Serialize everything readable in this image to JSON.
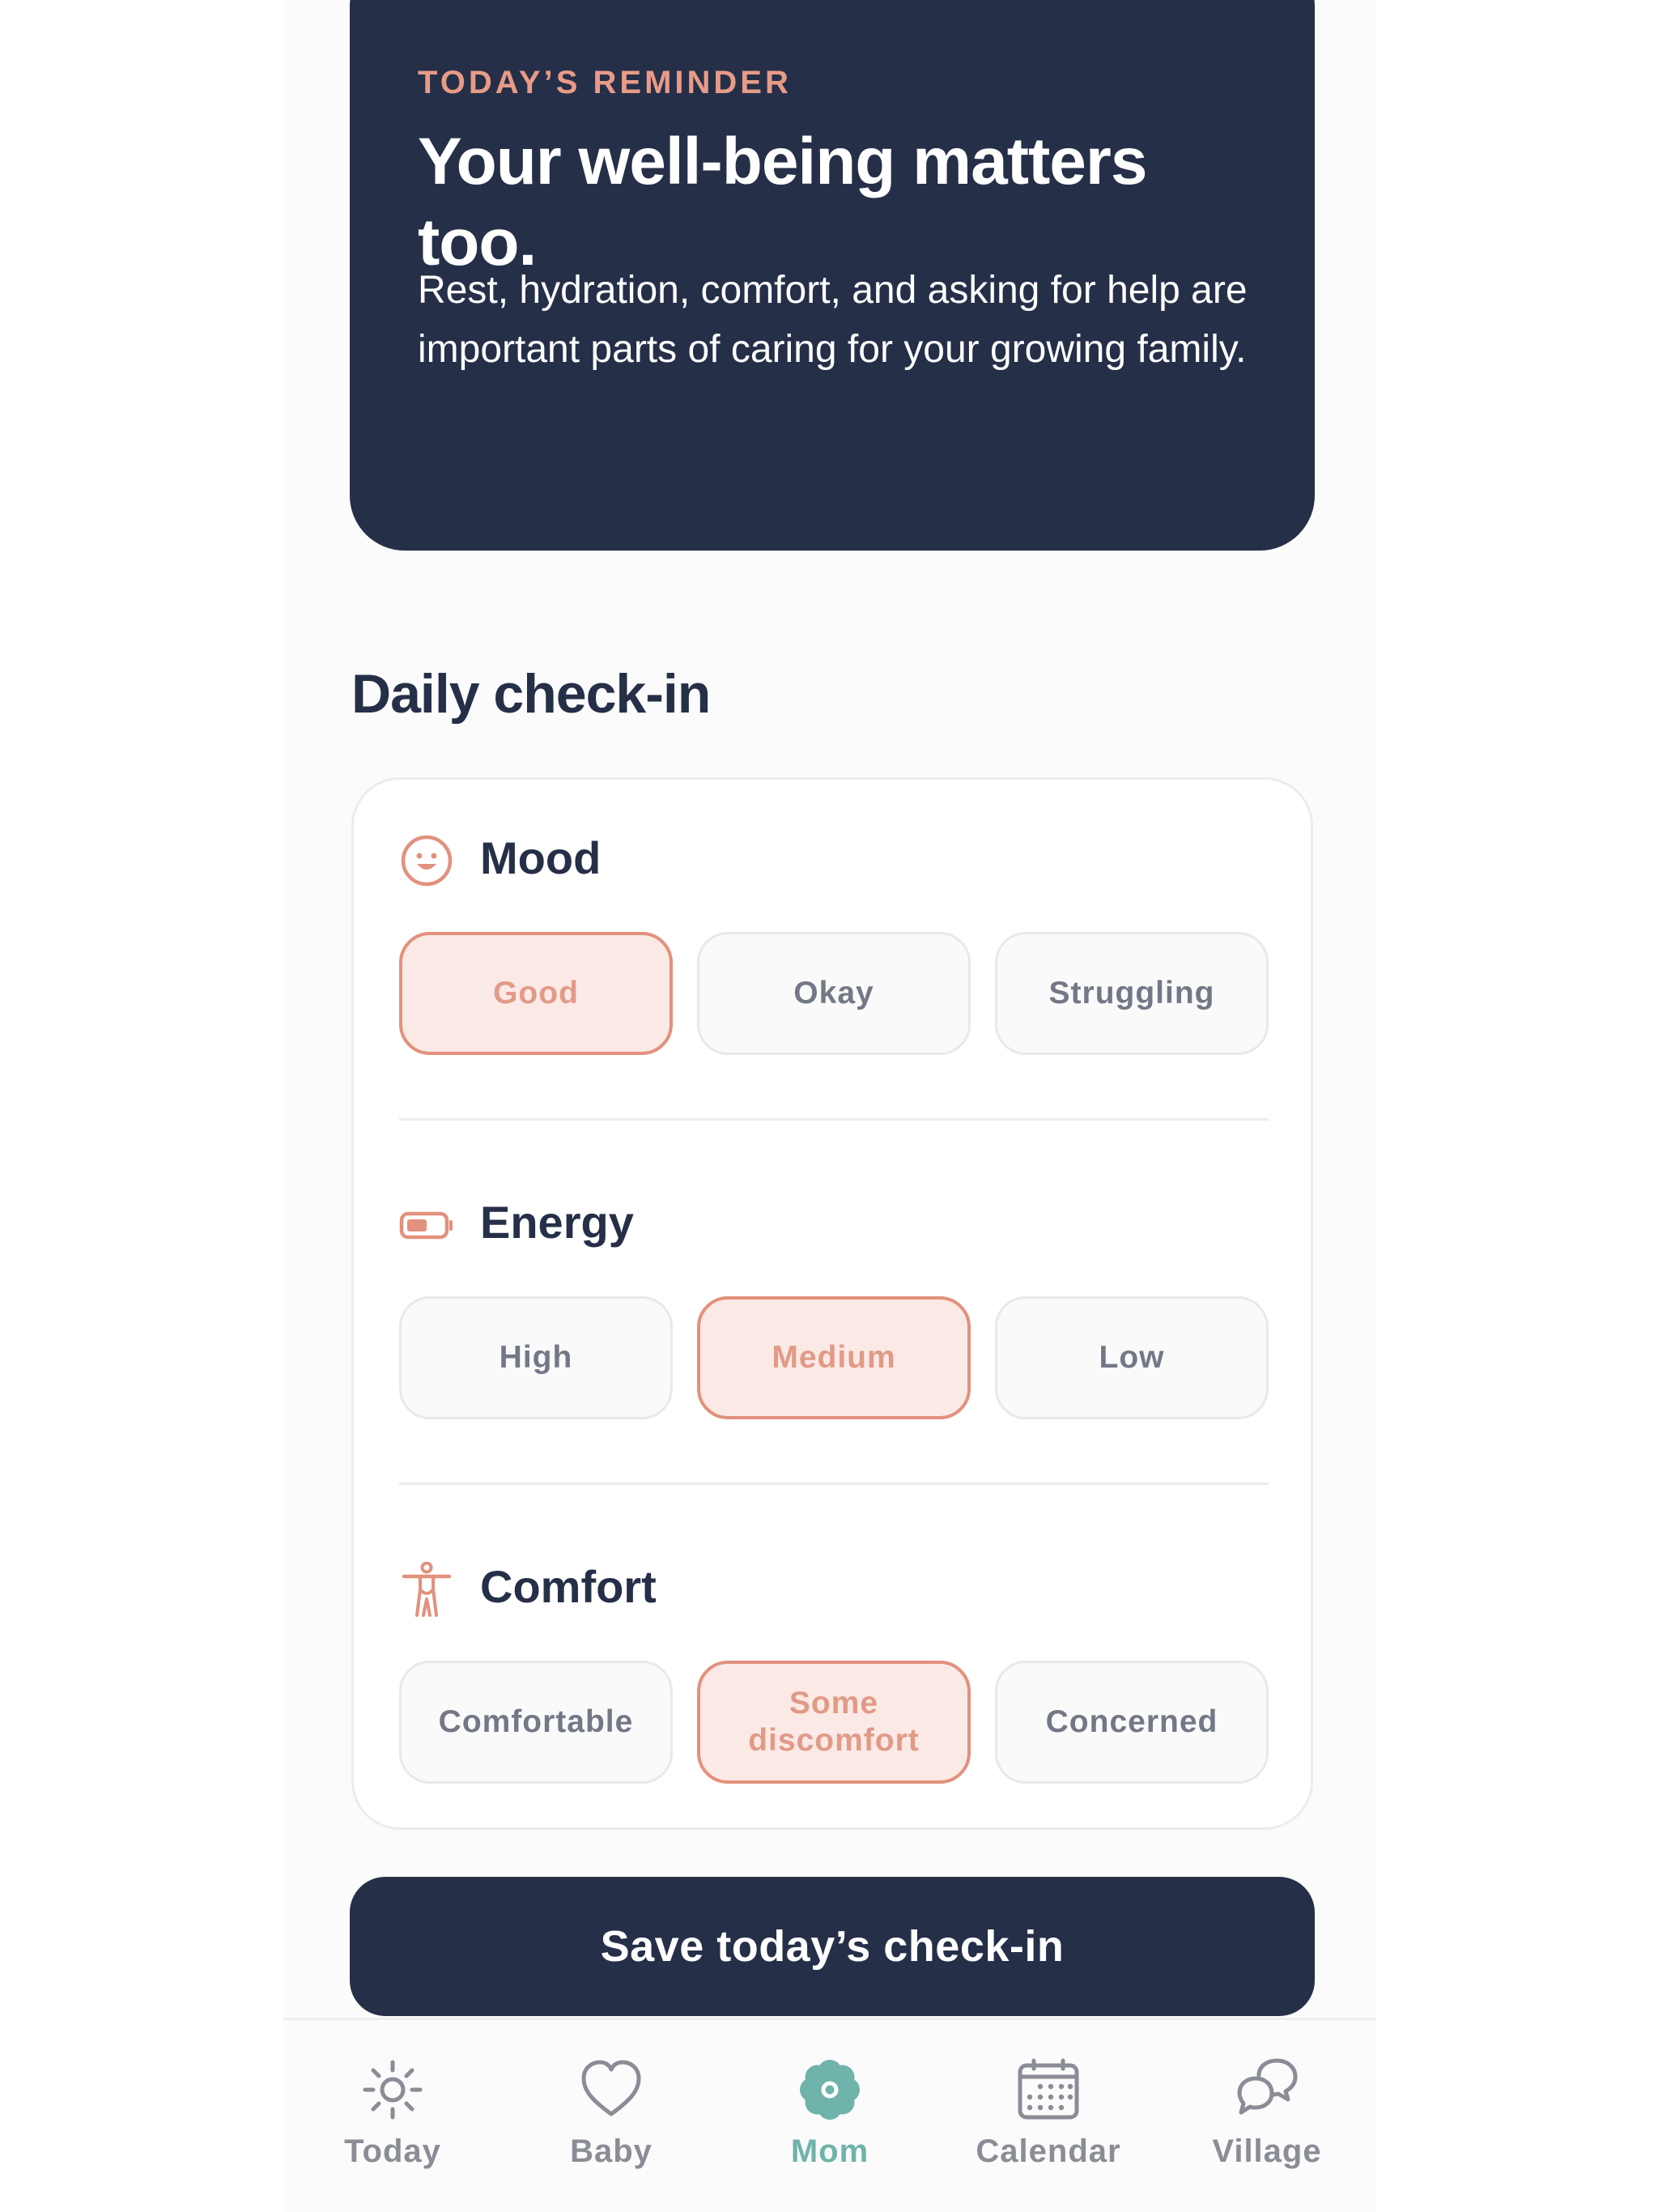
{
  "reminder": {
    "eyebrow": "TODAY’S REMINDER",
    "title": "Your well-being matters too.",
    "body": "Rest, hydration, comfort, and asking for help are important parts of caring for your growing family."
  },
  "checkin": {
    "title": "Daily check-in",
    "groups": [
      {
        "label": "Mood",
        "icon": "smiley-face-icon",
        "options": [
          "Good",
          "Okay",
          "Struggling"
        ],
        "selected": "Good"
      },
      {
        "label": "Energy",
        "icon": "battery-icon",
        "options": [
          "High",
          "Medium",
          "Low"
        ],
        "selected": "Medium"
      },
      {
        "label": "Comfort",
        "icon": "person-icon",
        "options": [
          "Comfortable",
          "Some discomfort",
          "Concerned"
        ],
        "selected": "Some discomfort"
      }
    ],
    "save_label": "Save today’s check-in"
  },
  "tabs": [
    {
      "label": "Today",
      "icon": "sun-icon",
      "active": false
    },
    {
      "label": "Baby",
      "icon": "heart-icon",
      "active": false
    },
    {
      "label": "Mom",
      "icon": "flower-icon",
      "active": true
    },
    {
      "label": "Calendar",
      "icon": "calendar-icon",
      "active": false
    },
    {
      "label": "Village",
      "icon": "chat-bubbles-icon",
      "active": false
    }
  ],
  "colors": {
    "navy": "#262f48",
    "accent": "#e2917d",
    "accent_bg": "#fbe9e5",
    "active_tab": "#6fb3aa"
  }
}
